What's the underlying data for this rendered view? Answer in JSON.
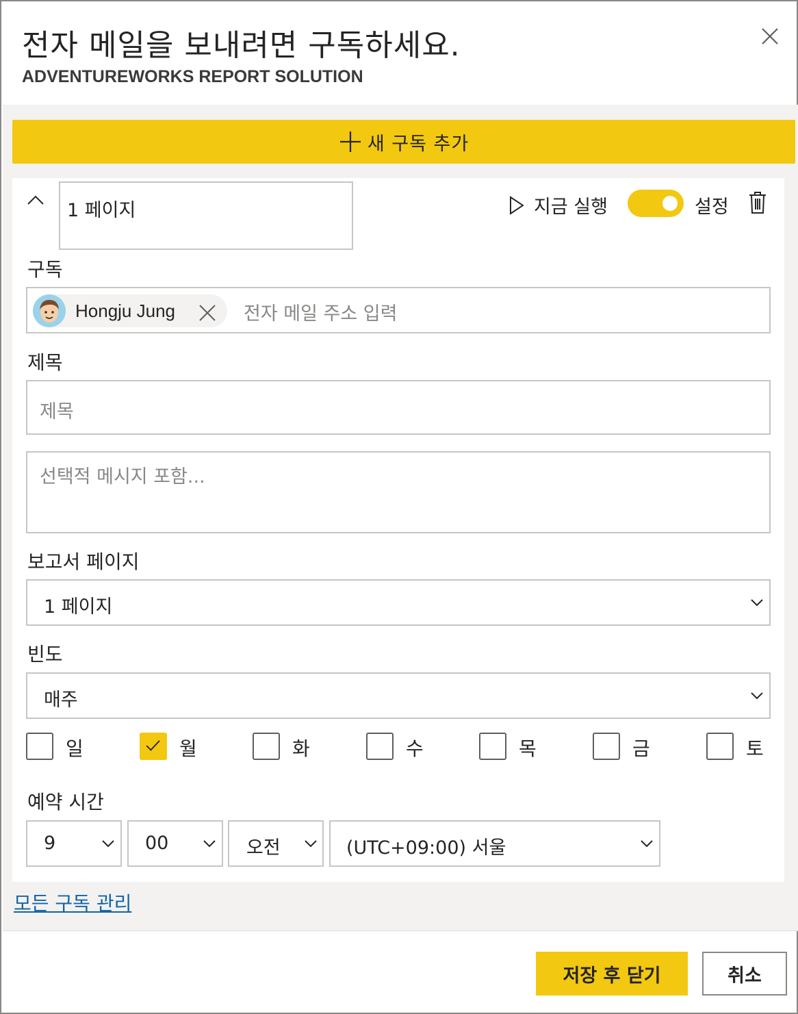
{
  "dialog": {
    "title": "전자 메일을 보내려면 구독하세요.",
    "subtitle": "ADVENTUREWORKS REPORT SOLUTION",
    "close_icon": "close-icon"
  },
  "add_subscription": {
    "label": "새 구독 추가",
    "icon": "plus-icon"
  },
  "subscription": {
    "name": "1 페이지",
    "run_now_label": "지금 실행",
    "enabled": true,
    "settings_label": "설정",
    "delete_icon": "trash-icon",
    "recipients": {
      "label": "구독",
      "chips": [
        {
          "name": "Hongju Jung"
        }
      ],
      "placeholder": "전자 메일 주소 입력"
    },
    "subject": {
      "label": "제목",
      "placeholder": "제목"
    },
    "message": {
      "placeholder": "선택적 메시지 포함..."
    },
    "report_page": {
      "label": "보고서 페이지",
      "selected": "1 페이지"
    },
    "frequency": {
      "label": "빈도",
      "selected": "매주"
    },
    "days": [
      {
        "label": "일",
        "checked": false
      },
      {
        "label": "월",
        "checked": true
      },
      {
        "label": "화",
        "checked": false
      },
      {
        "label": "수",
        "checked": false
      },
      {
        "label": "목",
        "checked": false
      },
      {
        "label": "금",
        "checked": false
      },
      {
        "label": "토",
        "checked": false
      }
    ],
    "schedule": {
      "label": "예약 시간",
      "hour": "9",
      "minute": "00",
      "ampm": "오전",
      "timezone": "(UTC+09:00) 서울"
    }
  },
  "manage_link": "모든 구독 관리",
  "footer": {
    "save_label": "저장 후 닫기",
    "cancel_label": "취소"
  },
  "colors": {
    "accent": "#f2c811",
    "link": "#1464a5",
    "border": "#c8c6c4"
  }
}
